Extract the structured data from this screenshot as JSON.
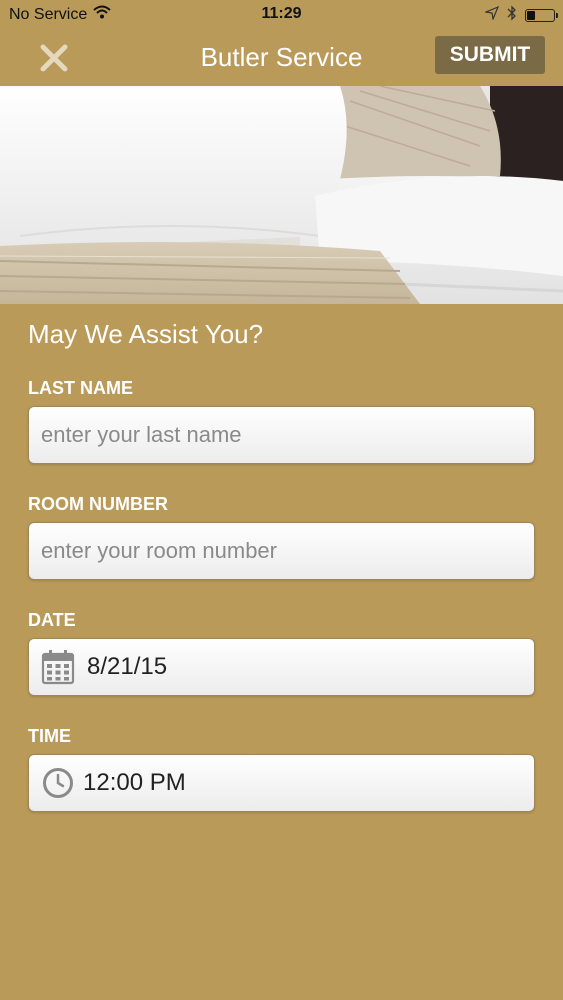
{
  "status_bar": {
    "carrier": "No Service",
    "time": "11:29",
    "icons": [
      "wifi-icon",
      "location-icon",
      "bluetooth-icon",
      "battery-icon"
    ],
    "battery_level": 0.3
  },
  "nav": {
    "title": "Butler Service",
    "close_icon": "close-icon",
    "submit_label": "SUBMIT"
  },
  "form": {
    "heading": "May We Assist You?",
    "last_name": {
      "label": "LAST NAME",
      "placeholder": "enter your last name",
      "value": ""
    },
    "room_number": {
      "label": "ROOM NUMBER",
      "placeholder": "enter your room number",
      "value": ""
    },
    "date": {
      "label": "DATE",
      "icon": "calendar-icon",
      "value": "8/21/15"
    },
    "time": {
      "label": "TIME",
      "icon": "clock-icon",
      "value": "12:00 PM"
    }
  },
  "colors": {
    "background": "#b99a58",
    "submit_bg": "#7a6a46",
    "text_light": "#ffffff"
  }
}
